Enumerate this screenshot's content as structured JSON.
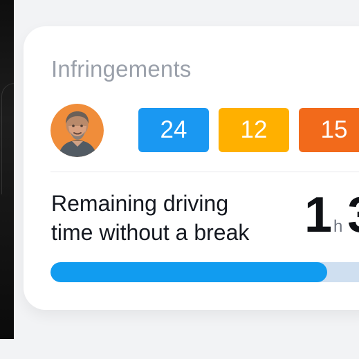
{
  "card": {
    "title": "Infringements",
    "avatar": {
      "icon": "driver-avatar"
    },
    "badges": [
      {
        "label": "24",
        "color": "#1a98f2"
      },
      {
        "label": "12",
        "color": "#ffb000"
      },
      {
        "label": "15",
        "color": "#f26a1b"
      }
    ],
    "remaining": {
      "label_line1": "Remaining driving",
      "label_line2": "time without a break",
      "hours": "1",
      "hours_unit": "h",
      "next_digit_partial": "3"
    },
    "progress": {
      "fraction_visible": 0.85,
      "fill_color": "#119cf0",
      "track_color": "#cfdff0"
    }
  }
}
